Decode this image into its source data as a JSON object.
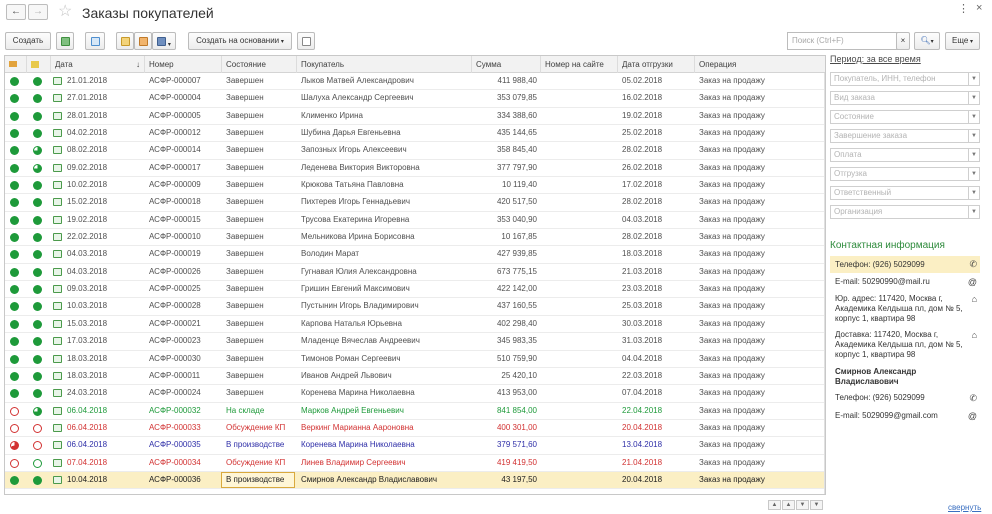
{
  "window": {
    "title": "Заказы покупателей",
    "close_glyph": "×",
    "more_glyph": "⋮"
  },
  "toolbar": {
    "create_label": "Создать",
    "create_based_label": "Создать на основании",
    "search_placeholder": "Поиск (Ctrl+F)",
    "more_label": "Еще"
  },
  "table": {
    "columns": [
      "Дата",
      "Номер",
      "Состояние",
      "Покупатель",
      "Сумма",
      "Номер на сайте",
      "Дата отгрузки",
      "Операция"
    ],
    "rows": [
      {
        "s1": "full",
        "s2": "full",
        "date": "21.01.2018",
        "num": "АСФР-000007",
        "state": "Завершен",
        "buyer": "Лыков Матвей Александрович",
        "sum": "411 988,40",
        "site": "",
        "ship": "05.02.2018",
        "op": "Заказ на продажу",
        "tone": "normal"
      },
      {
        "s1": "full",
        "s2": "full",
        "date": "27.01.2018",
        "num": "АСФР-000004",
        "state": "Завершен",
        "buyer": "Шалуха Александр Сергеевич",
        "sum": "353 079,85",
        "site": "",
        "ship": "16.02.2018",
        "op": "Заказ на продажу",
        "tone": "normal"
      },
      {
        "s1": "full",
        "s2": "full",
        "date": "28.01.2018",
        "num": "АСФР-000005",
        "state": "Завершен",
        "buyer": "Клименко Ирина",
        "sum": "334 388,60",
        "site": "",
        "ship": "19.02.2018",
        "op": "Заказ на продажу",
        "tone": "normal"
      },
      {
        "s1": "full",
        "s2": "full",
        "date": "04.02.2018",
        "num": "АСФР-000012",
        "state": "Завершен",
        "buyer": "Шубина Дарья Евгеньевна",
        "sum": "435 144,65",
        "site": "",
        "ship": "25.02.2018",
        "op": "Заказ на продажу",
        "tone": "normal"
      },
      {
        "s1": "full",
        "s2": "part",
        "date": "08.02.2018",
        "num": "АСФР-000014",
        "state": "Завершен",
        "buyer": "Запозных Игорь Алексеевич",
        "sum": "358 845,40",
        "site": "",
        "ship": "28.02.2018",
        "op": "Заказ на продажу",
        "tone": "normal"
      },
      {
        "s1": "full",
        "s2": "part",
        "date": "09.02.2018",
        "num": "АСФР-000017",
        "state": "Завершен",
        "buyer": "Леденева Виктория Викторовна",
        "sum": "377 797,90",
        "site": "",
        "ship": "26.02.2018",
        "op": "Заказ на продажу",
        "tone": "normal"
      },
      {
        "s1": "full",
        "s2": "full",
        "date": "10.02.2018",
        "num": "АСФР-000009",
        "state": "Завершен",
        "buyer": "Крюкова Татьяна Павловна",
        "sum": "10 119,40",
        "site": "",
        "ship": "17.02.2018",
        "op": "Заказ на продажу",
        "tone": "normal"
      },
      {
        "s1": "full",
        "s2": "full",
        "date": "15.02.2018",
        "num": "АСФР-000018",
        "state": "Завершен",
        "buyer": "Пихтерев Игорь Геннадьевич",
        "sum": "420 517,50",
        "site": "",
        "ship": "28.02.2018",
        "op": "Заказ на продажу",
        "tone": "normal"
      },
      {
        "s1": "full",
        "s2": "full",
        "date": "19.02.2018",
        "num": "АСФР-000015",
        "state": "Завершен",
        "buyer": "Трусова Екатерина Игоревна",
        "sum": "353 040,90",
        "site": "",
        "ship": "04.03.2018",
        "op": "Заказ на продажу",
        "tone": "normal"
      },
      {
        "s1": "full",
        "s2": "full",
        "date": "22.02.2018",
        "num": "АСФР-000010",
        "state": "Завершен",
        "buyer": "Мельникова Ирина Борисовна",
        "sum": "10 167,85",
        "site": "",
        "ship": "28.02.2018",
        "op": "Заказ на продажу",
        "tone": "normal"
      },
      {
        "s1": "full",
        "s2": "full",
        "date": "04.03.2018",
        "num": "АСФР-000019",
        "state": "Завершен",
        "buyer": "Володин Марат",
        "sum": "427 939,85",
        "site": "",
        "ship": "18.03.2018",
        "op": "Заказ на продажу",
        "tone": "normal"
      },
      {
        "s1": "full",
        "s2": "full",
        "date": "04.03.2018",
        "num": "АСФР-000026",
        "state": "Завершен",
        "buyer": "Гугнавая Юлия Александровна",
        "sum": "673 775,15",
        "site": "",
        "ship": "21.03.2018",
        "op": "Заказ на продажу",
        "tone": "normal"
      },
      {
        "s1": "full",
        "s2": "full",
        "date": "09.03.2018",
        "num": "АСФР-000025",
        "state": "Завершен",
        "buyer": "Гришин Евгений Максимович",
        "sum": "422 142,00",
        "site": "",
        "ship": "23.03.2018",
        "op": "Заказ на продажу",
        "tone": "normal"
      },
      {
        "s1": "full",
        "s2": "full",
        "date": "10.03.2018",
        "num": "АСФР-000028",
        "state": "Завершен",
        "buyer": "Пустынин Игорь Владимирович",
        "sum": "437 160,55",
        "site": "",
        "ship": "25.03.2018",
        "op": "Заказ на продажу",
        "tone": "normal"
      },
      {
        "s1": "full",
        "s2": "full",
        "date": "15.03.2018",
        "num": "АСФР-000021",
        "state": "Завершен",
        "buyer": "Карпова Наталья Юрьевна",
        "sum": "402 298,40",
        "site": "",
        "ship": "30.03.2018",
        "op": "Заказ на продажу",
        "tone": "normal"
      },
      {
        "s1": "full",
        "s2": "full",
        "date": "17.03.2018",
        "num": "АСФР-000023",
        "state": "Завершен",
        "buyer": "Младенце Вячеслав Андреевич",
        "sum": "345 983,35",
        "site": "",
        "ship": "31.03.2018",
        "op": "Заказ на продажу",
        "tone": "normal"
      },
      {
        "s1": "full",
        "s2": "full",
        "date": "18.03.2018",
        "num": "АСФР-000030",
        "state": "Завершен",
        "buyer": "Тимонов Роман Сергеевич",
        "sum": "510 759,90",
        "site": "",
        "ship": "04.04.2018",
        "op": "Заказ на продажу",
        "tone": "normal"
      },
      {
        "s1": "full",
        "s2": "full",
        "date": "18.03.2018",
        "num": "АСФР-000011",
        "state": "Завершен",
        "buyer": "Иванов Андрей Львович",
        "sum": "25 420,10",
        "site": "",
        "ship": "22.03.2018",
        "op": "Заказ на продажу",
        "tone": "normal"
      },
      {
        "s1": "full",
        "s2": "full",
        "date": "24.03.2018",
        "num": "АСФР-000024",
        "state": "Завершен",
        "buyer": "Коренева Марина Николаевна",
        "sum": "413 953,00",
        "site": "",
        "ship": "07.04.2018",
        "op": "Заказ на продажу",
        "tone": "normal"
      },
      {
        "s1": "red-empty",
        "s2": "part",
        "date": "06.04.2018",
        "num": "АСФР-000032",
        "state": "На складе",
        "buyer": "Марков Андрей Евгеньевич",
        "sum": "841 854,00",
        "site": "",
        "ship": "22.04.2018",
        "op": "Заказ на продажу",
        "tone": "green"
      },
      {
        "s1": "red-empty",
        "s2": "red-empty",
        "date": "06.04.2018",
        "num": "АСФР-000033",
        "state": "Обсуждение КП",
        "buyer": "Веркинг Марианна Аароновна",
        "sum": "400 301,00",
        "site": "",
        "ship": "20.04.2018",
        "op": "Заказ на продажу",
        "tone": "red"
      },
      {
        "s1": "red-part",
        "s2": "red-empty",
        "date": "06.04.2018",
        "num": "АСФР-000035",
        "state": "В производстве",
        "buyer": "Коренева Марина Николаевна",
        "sum": "379 571,60",
        "site": "",
        "ship": "13.04.2018",
        "op": "Заказ на продажу",
        "tone": "blue"
      },
      {
        "s1": "red-empty",
        "s2": "green-empty",
        "date": "07.04.2018",
        "num": "АСФР-000034",
        "state": "Обсуждение КП",
        "buyer": "Линев Владимир Сергеевич",
        "sum": "419 419,50",
        "site": "",
        "ship": "21.04.2018",
        "op": "Заказ на продажу",
        "tone": "red"
      },
      {
        "s1": "full",
        "s2": "full",
        "date": "10.04.2018",
        "num": "АСФР-000036",
        "state": "В производстве",
        "buyer": "Смирнов Александр Владиславович",
        "sum": "43 197,50",
        "site": "",
        "ship": "20.04.2018",
        "op": "Заказ на продажу",
        "tone": "dark",
        "selected": true
      }
    ]
  },
  "filters": {
    "period_label": "Период: за все время",
    "items": [
      "Покупатель, ИНН, телефон",
      "Вид заказа",
      "Состояние",
      "Завершение заказа",
      "Оплата",
      "Отгрузка",
      "Ответственный",
      "Организация"
    ]
  },
  "contact": {
    "title": "Контактная информация",
    "phone1": "Телефон: (926) 5029099",
    "email1": "E-mail: 50290990@mail.ru",
    "address1": "Юр. адрес: 117420, Москва г, Академика Келдыша пл, дом № 5, корпус 1, квартира 98",
    "delivery": "Доставка: 117420, Москва г, Академика Келдыша пл, дом № 5, корпус 1, квартира 98",
    "person": "Смирнов Александр Владиславович",
    "phone2": "Телефон: (926) 5029099",
    "email2": "E-mail: 5029099@gmail.com"
  },
  "footer": {
    "collapse_label": "свернуть"
  },
  "colors": {
    "green": "#1e9a3a",
    "red": "#d23232",
    "blue": "#2f2fa8",
    "accent": "#2e8b3c"
  }
}
